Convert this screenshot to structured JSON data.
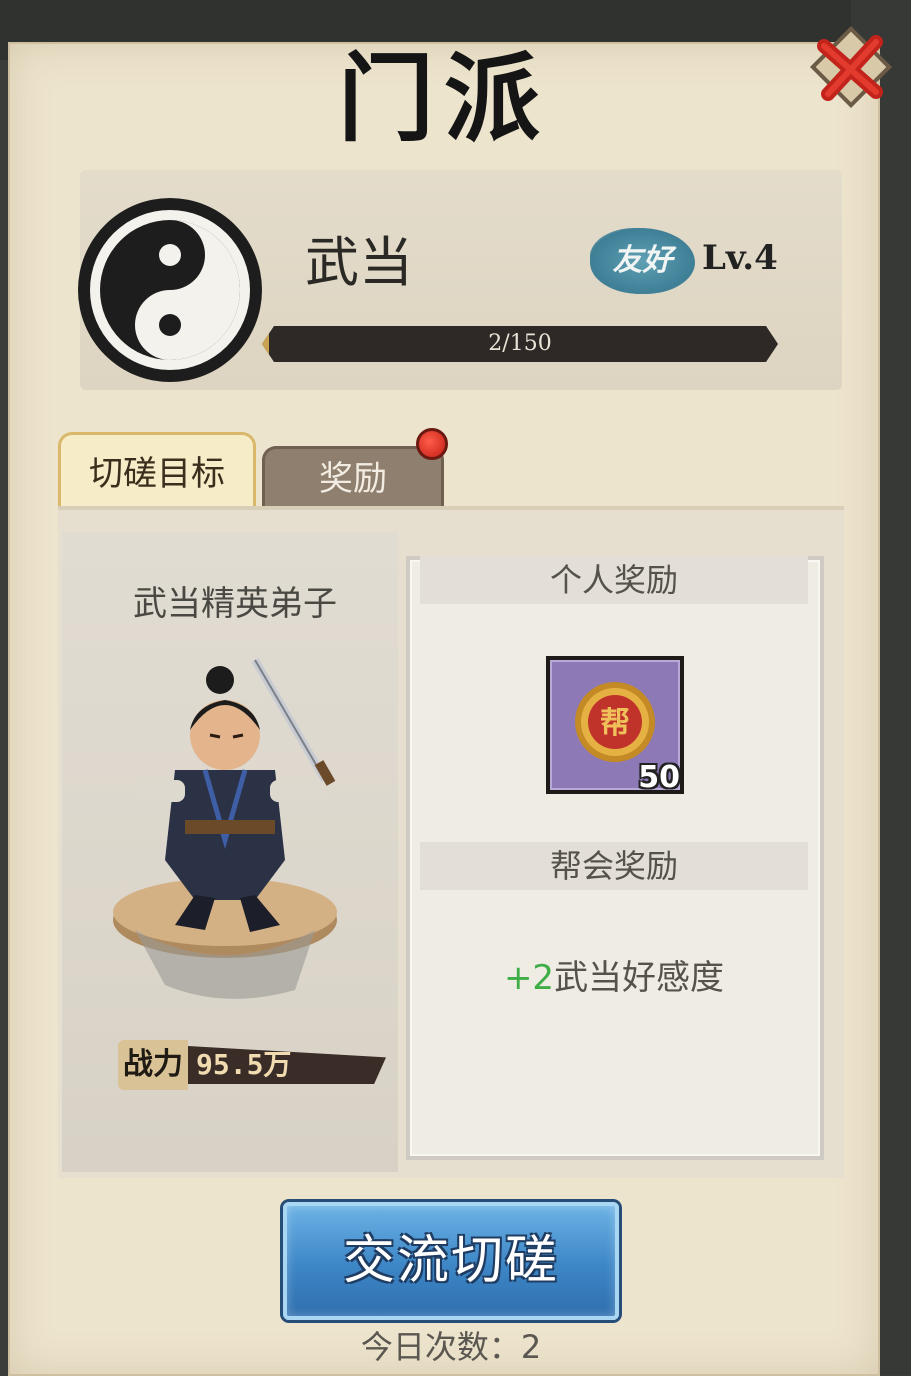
{
  "dialog": {
    "title": "门派",
    "close_icon": "close-x-icon"
  },
  "sect": {
    "name": "武当",
    "emblem_icon": "yin-yang-icon",
    "relation": "友好",
    "level": "Lv.4",
    "progress_text": "2/150",
    "progress": 0.0133
  },
  "tabs": [
    {
      "label": "切磋目标",
      "active": true
    },
    {
      "label": "奖励",
      "active": false,
      "has_notification": true
    }
  ],
  "opponent": {
    "name": "武当精英弟子",
    "power_label": "战力",
    "power_value": "95.5万"
  },
  "rewards": {
    "personal_header": "个人奖励",
    "personal_item_icon": "guild-coin-icon",
    "personal_item_glyph": "帮",
    "personal_item_count": "50",
    "guild_header": "帮会奖励",
    "guild_plus": "+2",
    "guild_text": "武当好感度"
  },
  "actions": {
    "spar_button": "交流切磋",
    "daily_count_label": "今日次数：",
    "daily_count_value": "2"
  },
  "colors": {
    "panel": "#ede4cd",
    "button_blue": "#3d86c6",
    "positive_green": "#3fae47",
    "notification_red": "#c31d13"
  }
}
